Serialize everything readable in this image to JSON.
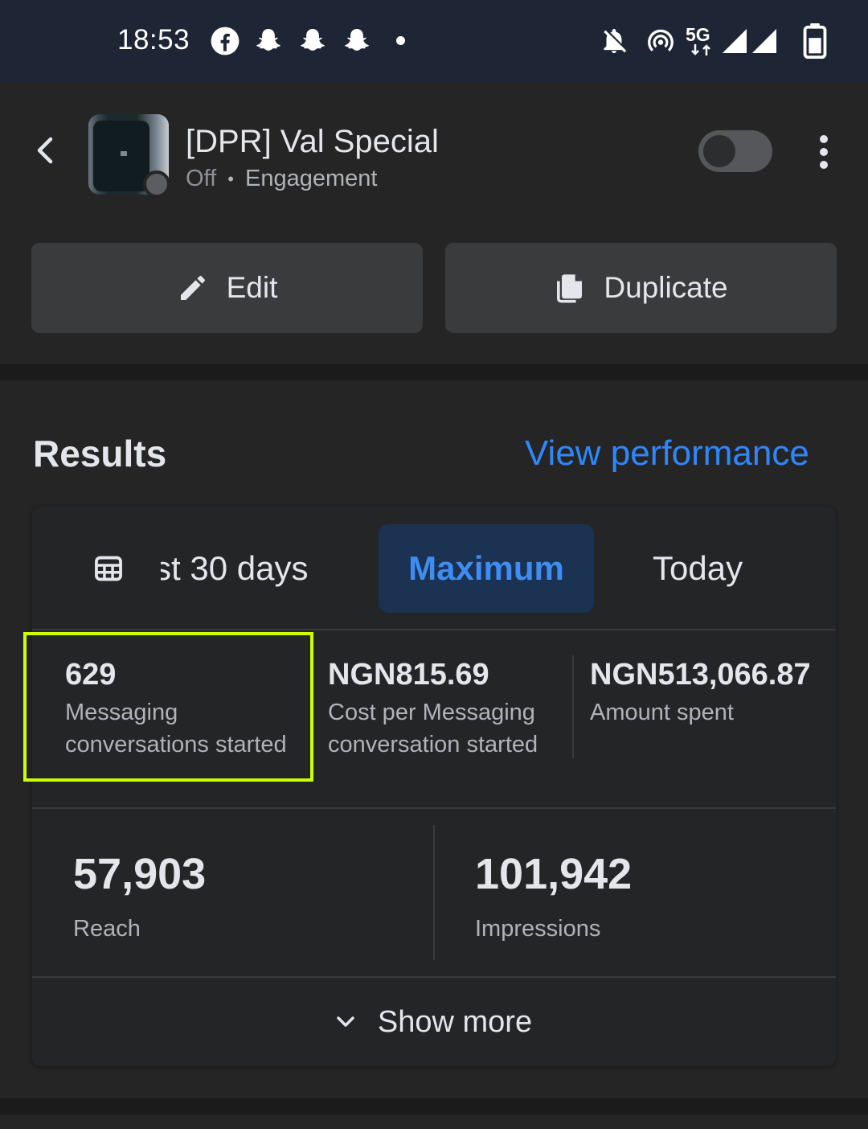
{
  "status_bar": {
    "time": "18:53",
    "icons": [
      "facebook-icon",
      "snapchat-icon",
      "snapchat-icon",
      "snapchat-icon",
      "notification-dot",
      "bell-off-icon",
      "hotspot-icon",
      "5g-icon",
      "signal-icon",
      "signal-icon",
      "battery-icon"
    ],
    "network_label": "5G"
  },
  "header": {
    "campaign_name": "[DPR] Val Special",
    "status": "Off",
    "separator": "•",
    "objective": "Engagement",
    "toggle_on": false
  },
  "actions": {
    "edit_label": "Edit",
    "duplicate_label": "Duplicate"
  },
  "results": {
    "title": "Results",
    "view_performance": "View performance",
    "tabs": {
      "last30": "st 30 days",
      "maximum": "Maximum",
      "today": "Today"
    },
    "selected_tab": "Maximum",
    "metrics": [
      {
        "value": "629",
        "label": "Messaging conversations started"
      },
      {
        "value": "NGN815.69",
        "label": "Cost per Messaging conversation started"
      },
      {
        "value": "NGN513,066.87",
        "label": "Amount spent"
      }
    ],
    "reach": {
      "value": "57,903",
      "label": "Reach"
    },
    "impressions": {
      "value": "101,942",
      "label": "Impressions"
    },
    "show_more": "Show more"
  },
  "colors": {
    "accent": "#2d88ff",
    "selected_tab_bg": "#1c3252",
    "highlight": "#ccff00",
    "status_bar_bg": "#1e2636"
  }
}
